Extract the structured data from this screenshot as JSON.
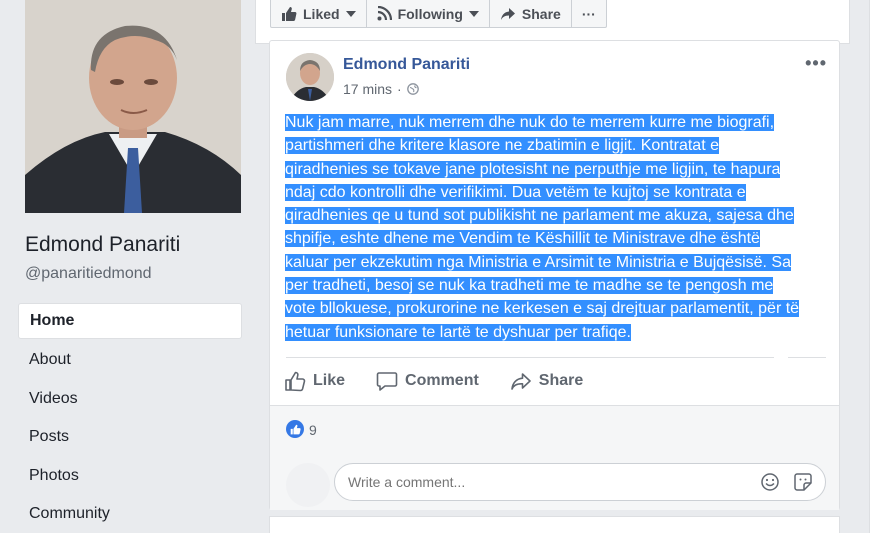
{
  "page": {
    "name": "Edmond Panariti",
    "handle": "@panaritiedmond"
  },
  "sidebar": {
    "items": [
      {
        "label": "Home",
        "active": true
      },
      {
        "label": "About"
      },
      {
        "label": "Videos"
      },
      {
        "label": "Posts"
      },
      {
        "label": "Photos"
      },
      {
        "label": "Community"
      }
    ]
  },
  "action_bar": {
    "liked_label": "Liked",
    "following_label": "Following",
    "share_label": "Share",
    "more_label": "···"
  },
  "post": {
    "author": "Edmond Panariti",
    "time": "17 mins",
    "dot": "·",
    "more_label": "•••",
    "lines": [
      "Nuk jam marre, nuk merrem dhe nuk do te merrem kurre me biografi,",
      "partishmeri dhe kritere klasore ne zbatimin e ligjit. Kontratat e",
      "qiradhenies se tokave jane plotesisht ne perputhje me ligjin, te hapura",
      "ndaj cdo kontrolli dhe verifikimi. Dua vetëm te kujtoj se kontrata e",
      "qiradhenies qe u tund sot publikisht ne parlament me akuza, sajesa dhe",
      "shpifje, eshte dhene me Vendim te Këshillit te Ministrave dhe është",
      "kaluar per ekzekutim nga Ministria e Arsimit te Ministria e Bujqësisë. Sa",
      "per tradheti, besoj se nuk ka tradheti me te madhe se te pengosh me",
      "vote bllokuese, prokurorine ne kerkesen e saj drejtuar parlamentit, për të",
      "hetuar funksionare te lartë te dyshuar per trafiqe."
    ],
    "actions": {
      "like": "Like",
      "comment": "Comment",
      "share": "Share"
    },
    "like_count": "9",
    "comment_placeholder": "Write a comment..."
  },
  "colors": {
    "link": "#365899",
    "selection": "#338fff",
    "like_badge": "#3578e5"
  }
}
